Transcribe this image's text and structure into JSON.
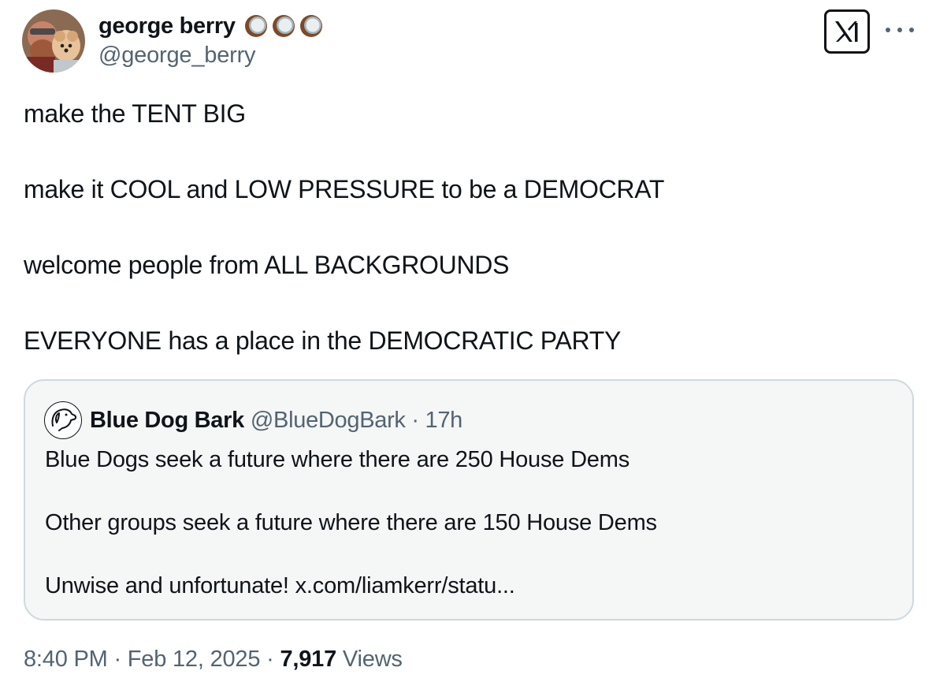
{
  "author": {
    "display_name": "george berry",
    "handle": "@george_berry",
    "emojis": [
      "coconut-icon",
      "coconut-icon",
      "coconut-icon"
    ]
  },
  "tweet": {
    "paragraphs": [
      "make the TENT BIG",
      "make it COOL and LOW PRESSURE to be a DEMOCRAT",
      "welcome people from ALL BACKGROUNDS",
      "EVERYONE has a place in the DEMOCRATIC PARTY"
    ]
  },
  "quote": {
    "display_name": "Blue Dog Bark",
    "meta": "@BlueDogBark · 17h",
    "paragraphs": [
      "Blue Dogs seek a future where there are 250 House Dems",
      "Other groups seek a future where there are 150 House Dems",
      "Unwise and unfortunate! x.com/liamkerr/statu..."
    ]
  },
  "footer": {
    "timestamp": "8:40 PM · Feb 12, 2025 · ",
    "view_count": "7,917",
    "views_label": " Views"
  },
  "colors": {
    "text": "#0f1419",
    "secondary": "#536471",
    "border": "#cfd9de",
    "quote_bg": "#f5f6f6"
  }
}
